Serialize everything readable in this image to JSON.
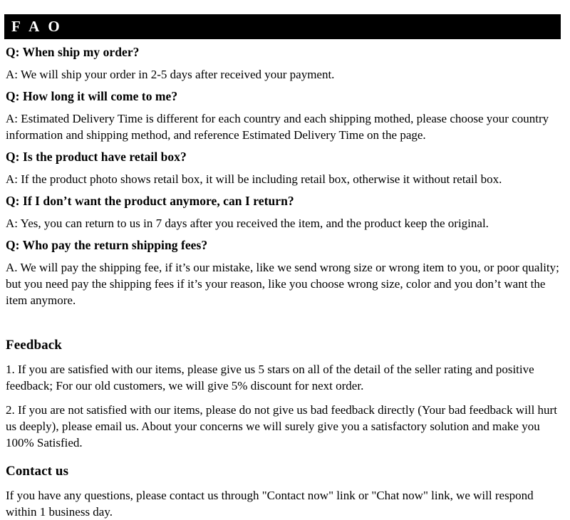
{
  "header": {
    "title": "F A O",
    "background_color": "#000000",
    "text_color": "#ffffff"
  },
  "faq": {
    "items": [
      {
        "question": "Q: When ship my order?",
        "answer": "A: We will ship your order in 2-5 days after received your payment."
      },
      {
        "question": "Q: How long it will come to me?",
        "answer": "A: Estimated Delivery Time is different for each country and each shipping mothed, please choose your country information and shipping method, and reference Estimated Delivery Time on the page."
      },
      {
        "question": "Q: Is the product have retail box?",
        "answer": "A: If  the product photo shows retail box, it will be including retail box, otherwise it without retail box."
      },
      {
        "question": "Q: If  I don’t want the product anymore, can I return?",
        "answer": "A: Yes, you can return to us in 7 days after you received the item, and the product keep the original."
      },
      {
        "question": "Q: Who pay the return shipping fees?",
        "answer": "A.  We will pay the shipping fee, if  it’s our mistake, like we send wrong size or wrong item to you, or poor quality; but you need pay the shipping fees if  it’s your reason, like you choose wrong size, color and you don’t want the item anymore."
      }
    ]
  },
  "feedback": {
    "heading": "Feedback",
    "item_1": "1.  If you are satisfied with our items, please give us 5 stars on all of the detail of the seller rating and positive feedback; For our old customers, we will give 5% discount for next order.",
    "item_2": "2.  If you are not satisfied with our items, please do not give us bad feedback directly (Your bad feedback will hurt us deeply), please email us. About your concerns we will surely give you a satisfactory solution and make you 100% Satisfied."
  },
  "contact": {
    "heading": "Contact us",
    "body": "If you have any questions, please contact us through \"Contact now\" link or \"Chat now\" link, we will respond within 1 business day."
  }
}
